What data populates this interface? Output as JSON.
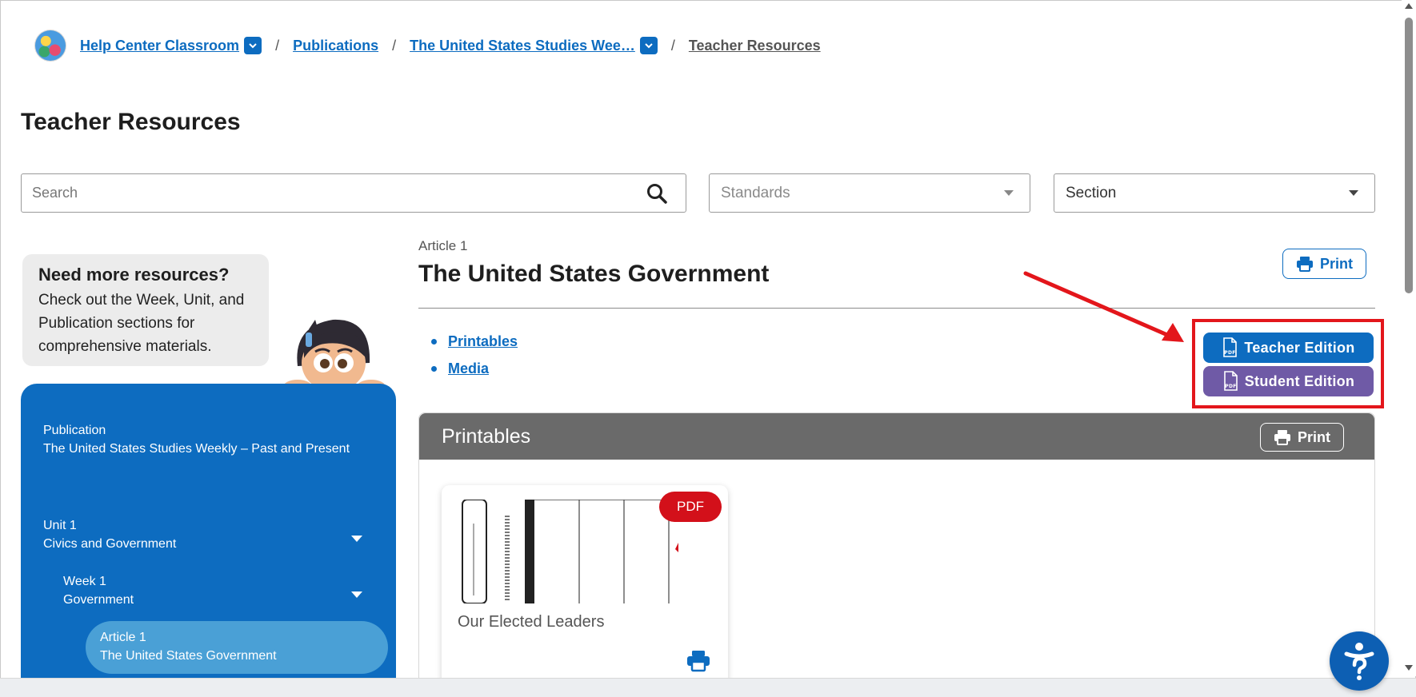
{
  "breadcrumb": {
    "items": [
      {
        "label": "Help Center Classroom",
        "has_dropdown": true
      },
      {
        "label": "Publications",
        "has_dropdown": false
      },
      {
        "label": "The United States Studies Wee…",
        "has_dropdown": true
      },
      {
        "label": "Teacher Resources",
        "has_dropdown": false,
        "current": true
      }
    ],
    "separator": "/"
  },
  "page": {
    "title": "Teacher Resources"
  },
  "filters": {
    "search_placeholder": "Search",
    "standards_placeholder": "Standards",
    "section_value": "Section"
  },
  "sidebar": {
    "promo_title": "Need more resources?",
    "promo_text": "Check out the Week, Unit, and Publication sections for comprehensive materials.",
    "publication_label": "Publication",
    "publication_name": "The United States Studies Weekly – Past and Present",
    "unit_label": "Unit 1",
    "unit_name": "Civics and Government",
    "week_label": "Week 1",
    "week_name": "Government",
    "article_label": "Article 1",
    "article_name": "The United States Government"
  },
  "article": {
    "kicker": "Article 1",
    "title": "The United States Government",
    "print_label": "Print",
    "anchors": [
      "Printables",
      "Media"
    ],
    "teacher_edition_label": "Teacher Edition",
    "student_edition_label": "Student Edition"
  },
  "printables": {
    "title": "Printables",
    "print_label": "Print",
    "cards": [
      {
        "title": "Our Elected Leaders",
        "badge": "PDF"
      }
    ]
  },
  "colors": {
    "brand_blue": "#0d6cc0",
    "student_purple": "#6f5aa6",
    "highlight_red": "#e3161b",
    "pdf_red": "#d3101a",
    "section_header_gray": "#6a6a6a"
  },
  "icons": {
    "search": "search-icon",
    "print": "printer-icon",
    "pdf_file": "pdf-file-icon",
    "dropdown": "chevron-down-icon",
    "help": "accessibility-help-icon"
  }
}
